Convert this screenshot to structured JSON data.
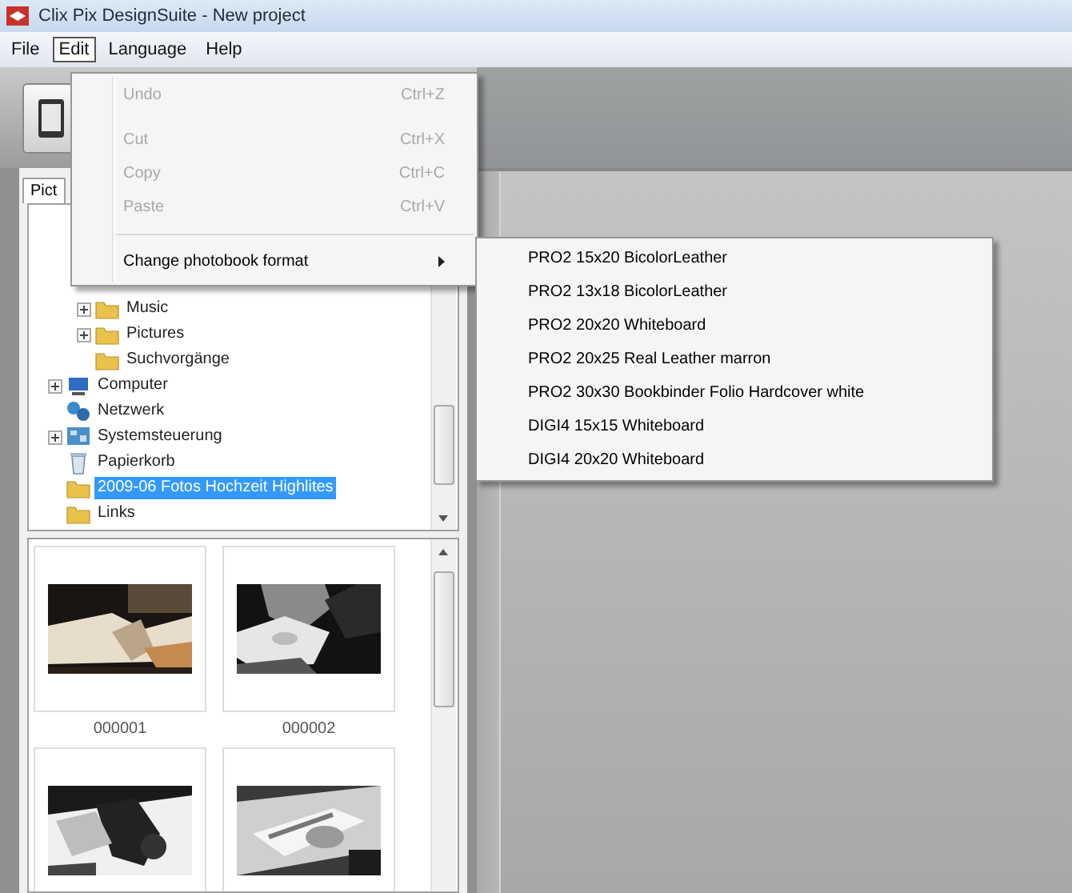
{
  "window": {
    "title": "Clix Pix DesignSuite - New project"
  },
  "menu_bar": [
    {
      "label": "File",
      "selected": false
    },
    {
      "label": "Edit",
      "selected": true
    },
    {
      "label": "Language",
      "selected": false
    },
    {
      "label": "Help",
      "selected": false
    }
  ],
  "edit_menu": [
    {
      "kind": "item",
      "label": "Undo",
      "shortcut": "Ctrl+Z",
      "disabled": true
    },
    {
      "kind": "item",
      "label": "Cut",
      "shortcut": "Ctrl+X",
      "disabled": true
    },
    {
      "kind": "item",
      "label": "Copy",
      "shortcut": "Ctrl+C",
      "disabled": true
    },
    {
      "kind": "item",
      "label": "Paste",
      "shortcut": "Ctrl+V",
      "disabled": true
    },
    {
      "kind": "separator"
    },
    {
      "kind": "submenu",
      "label": "Change photobook format",
      "disabled": false
    }
  ],
  "format_submenu": [
    "PRO2 15x20 BicolorLeather",
    "PRO2 13x18 BicolorLeather",
    "PRO2 20x20 Whiteboard",
    "PRO2 20x25 Real Leather marron",
    "PRO2 30x30 Bookbinder Folio Hardcover white",
    "DIGI4 15x15 Whiteboard",
    "DIGI4 20x20 Whiteboard"
  ],
  "left_panel": {
    "tab": "Pict",
    "tree": [
      {
        "children": [
          {
            "label": "Music",
            "kind": "folder",
            "collapsed": true,
            "selected": false
          },
          {
            "label": "Pictures",
            "kind": "folder",
            "collapsed": true,
            "selected": false
          },
          {
            "label": "Suchvorgänge",
            "kind": "folder",
            "collapsed": false,
            "selected": false
          }
        ]
      },
      {
        "label": "Computer",
        "kind": "computer",
        "collapsed": true,
        "selected": false
      },
      {
        "label": "Netzwerk",
        "kind": "network",
        "collapsed": false,
        "selected": false
      },
      {
        "label": "Systemsteuerung",
        "kind": "control-panel",
        "collapsed": true,
        "selected": false
      },
      {
        "label": "Papierkorb",
        "kind": "recycle-bin",
        "collapsed": false,
        "selected": false
      },
      {
        "label": "2009-06 Fotos Hochzeit Highlites",
        "kind": "folder",
        "collapsed": false,
        "selected": true
      },
      {
        "label": "Links",
        "kind": "folder",
        "collapsed": false,
        "selected": false
      }
    ],
    "thumbnails": [
      {
        "kind": "picture",
        "caption": "000001"
      },
      {
        "kind": "picture",
        "caption": "000002"
      },
      {
        "kind": "picture"
      },
      {
        "kind": "picture"
      }
    ]
  }
}
